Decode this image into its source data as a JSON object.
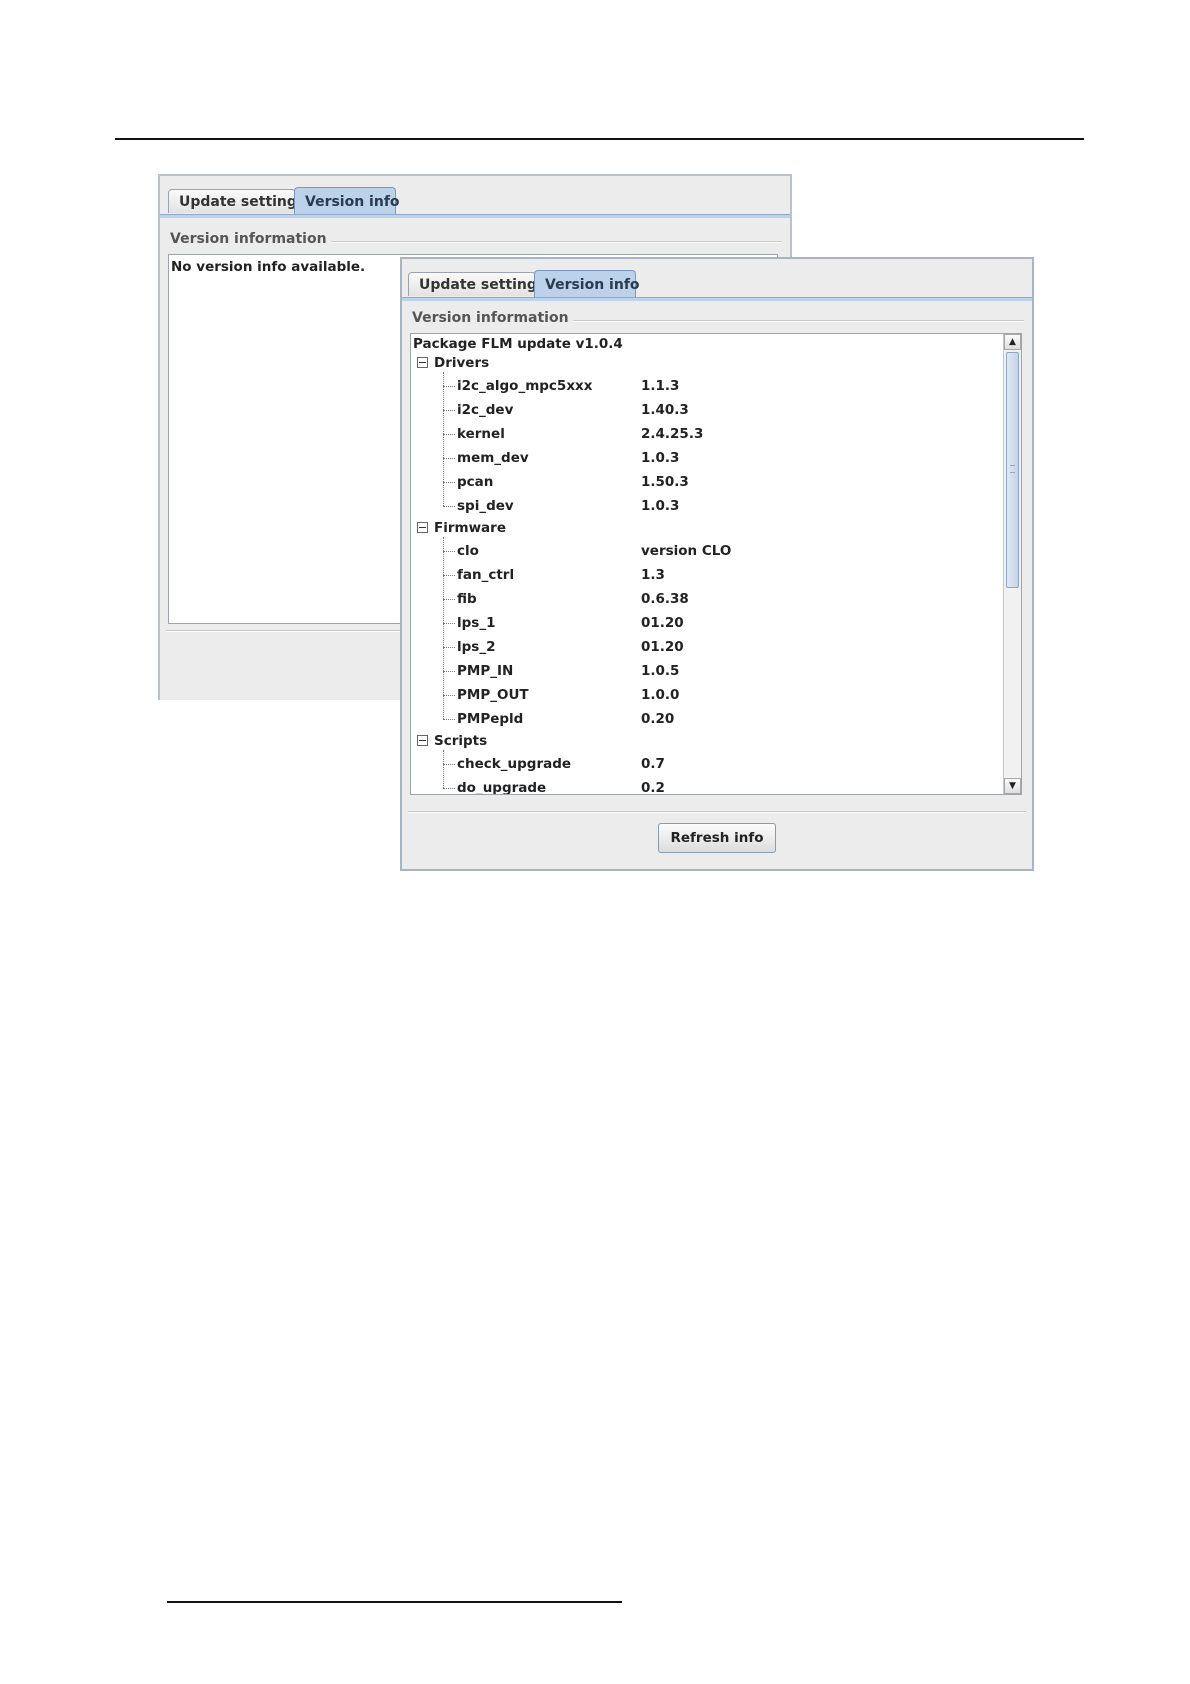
{
  "back_window": {
    "tabs": [
      {
        "label": "Update settings",
        "active": false
      },
      {
        "label": "Version info",
        "active": true
      }
    ],
    "group_title": "Version information",
    "message": "No version info available."
  },
  "front_window": {
    "tabs": [
      {
        "label": "Update settings",
        "active": false
      },
      {
        "label": "Version info",
        "active": true
      }
    ],
    "group_title": "Version information",
    "package": "Package FLM update v1.0.4",
    "categories": [
      {
        "label": "Drivers",
        "expanded": true,
        "items": [
          {
            "name": "i2c_algo_mpc5xxx",
            "version": "1.1.3"
          },
          {
            "name": "i2c_dev",
            "version": "1.40.3"
          },
          {
            "name": "kernel",
            "version": "2.4.25.3"
          },
          {
            "name": "mem_dev",
            "version": "1.0.3"
          },
          {
            "name": "pcan",
            "version": "1.50.3"
          },
          {
            "name": "spi_dev",
            "version": "1.0.3"
          }
        ]
      },
      {
        "label": "Firmware",
        "expanded": true,
        "items": [
          {
            "name": "clo",
            "version": "version CLO"
          },
          {
            "name": "fan_ctrl",
            "version": "1.3"
          },
          {
            "name": "fib",
            "version": "0.6.38"
          },
          {
            "name": "lps_1",
            "version": "01.20"
          },
          {
            "name": "lps_2",
            "version": "01.20"
          },
          {
            "name": "PMP_IN",
            "version": "1.0.5"
          },
          {
            "name": "PMP_OUT",
            "version": "1.0.0"
          },
          {
            "name": "PMPepld",
            "version": "0.20"
          }
        ]
      },
      {
        "label": "Scripts",
        "expanded": true,
        "items": [
          {
            "name": "check_upgrade",
            "version": "0.7"
          },
          {
            "name": "do_upgrade",
            "version": "0.2"
          }
        ]
      }
    ],
    "refresh_button": "Refresh info",
    "scrollbar": {
      "up_arrow": "▲",
      "down_arrow": "▼"
    }
  },
  "icons": {
    "tree_toggle": "collapse-icon",
    "scroll_up": "scroll-up-arrow-icon",
    "scroll_down": "scroll-down-arrow-icon"
  }
}
